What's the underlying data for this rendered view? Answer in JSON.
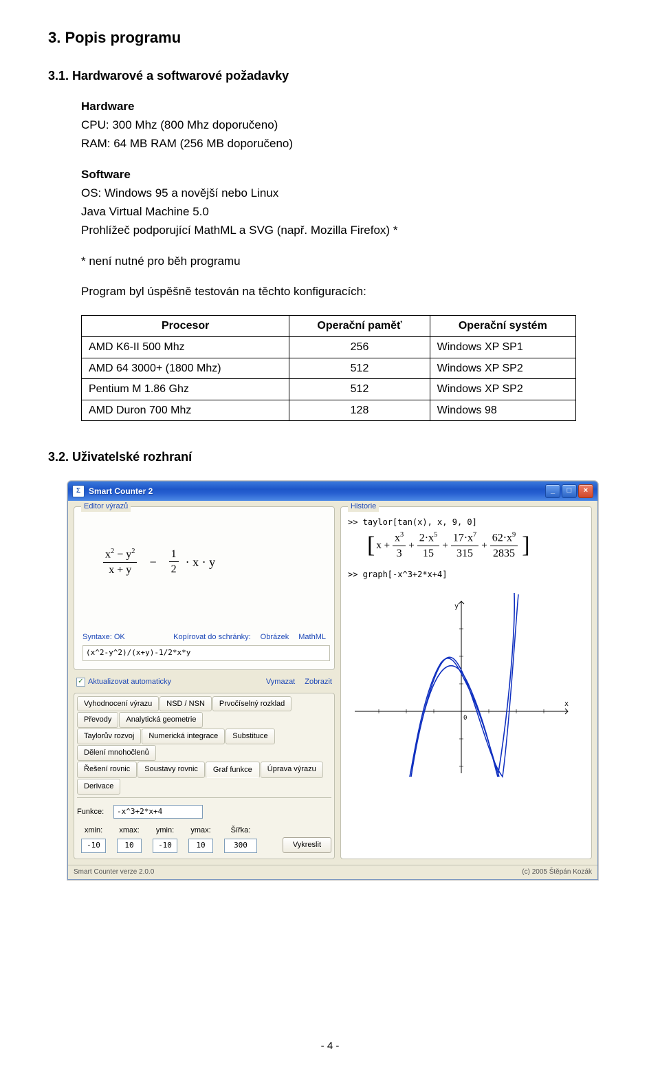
{
  "doc": {
    "h2": "3. Popis programu",
    "h3_1": "3.1. Hardwarové a softwarové požadavky",
    "hw_head": "Hardware",
    "hw_cpu": "CPU: 300 Mhz (800 Mhz doporučeno)",
    "hw_ram": "RAM: 64 MB RAM (256 MB doporučeno)",
    "sw_head": "Software",
    "sw_os": "OS: Windows 95 a novější nebo Linux",
    "sw_jvm": "Java Virtual Machine 5.0",
    "sw_browser": "Prohlížeč podporující MathML a SVG (např. Mozilla Firefox) *",
    "sw_note": "* není nutné pro běh programu",
    "tested": "Program byl úspěšně testován na těchto konfiguracích:",
    "table": {
      "headers": [
        "Procesor",
        "Operační paměť",
        "Operační systém"
      ],
      "rows": [
        [
          "AMD K6-II 500 Mhz",
          "256",
          "Windows XP SP1"
        ],
        [
          "AMD 64 3000+ (1800 Mhz)",
          "512",
          "Windows XP SP2"
        ],
        [
          "Pentium M 1.86 Ghz",
          "512",
          "Windows XP SP2"
        ],
        [
          "AMD Duron 700 Mhz",
          "128",
          "Windows 98"
        ]
      ]
    },
    "h3_2": "3.2. Uživatelské rozhraní",
    "pagenum": "- 4 -"
  },
  "ui": {
    "window_title": "Smart Counter 2",
    "editor_caption": "Editor výrazů",
    "history_caption": "Historie",
    "syntax_label": "Syntaxe:",
    "syntax_status": "OK",
    "copy_label": "Kopírovat do schránky:",
    "copy_image": "Obrázek",
    "copy_mathml": "MathML",
    "raw_expr": "(x^2-y^2)/(x+y)-1/2*x*y",
    "auto_label": "Aktualizovat automaticky",
    "clear_link": "Vymazat",
    "show_link": "Zobrazit",
    "tabs_r1": [
      "Vyhodnocení výrazu",
      "NSD / NSN",
      "Prvočíselný rozklad",
      "Převody",
      "Analytická geometrie"
    ],
    "tabs_r2": [
      "Taylorův rozvoj",
      "Numerická integrace",
      "Substituce",
      "Dělení mnohočlenů"
    ],
    "tabs_r3": [
      "Řešení rovnic",
      "Soustavy rovnic",
      "Graf funkce",
      "Úprava výrazu",
      "Derivace"
    ],
    "active_tab": "Graf funkce",
    "fn_label": "Funkce:",
    "fn_value": "-x^3+2*x+4",
    "num_labels": [
      "xmin:",
      "xmax:",
      "ymin:",
      "ymax:",
      "Šířka:"
    ],
    "num_values": [
      "-10",
      "10",
      "-10",
      "10",
      "300"
    ],
    "plot_btn": "Vykreslit",
    "hist_line1": ">> taylor[tan(x), x, 9, 0]",
    "hist_line2": ">> graph[-x^3+2*x+4]",
    "status_version": "Smart Counter verze 2.0.0",
    "status_author": "(c) 2005 Štěpán Kozák"
  }
}
